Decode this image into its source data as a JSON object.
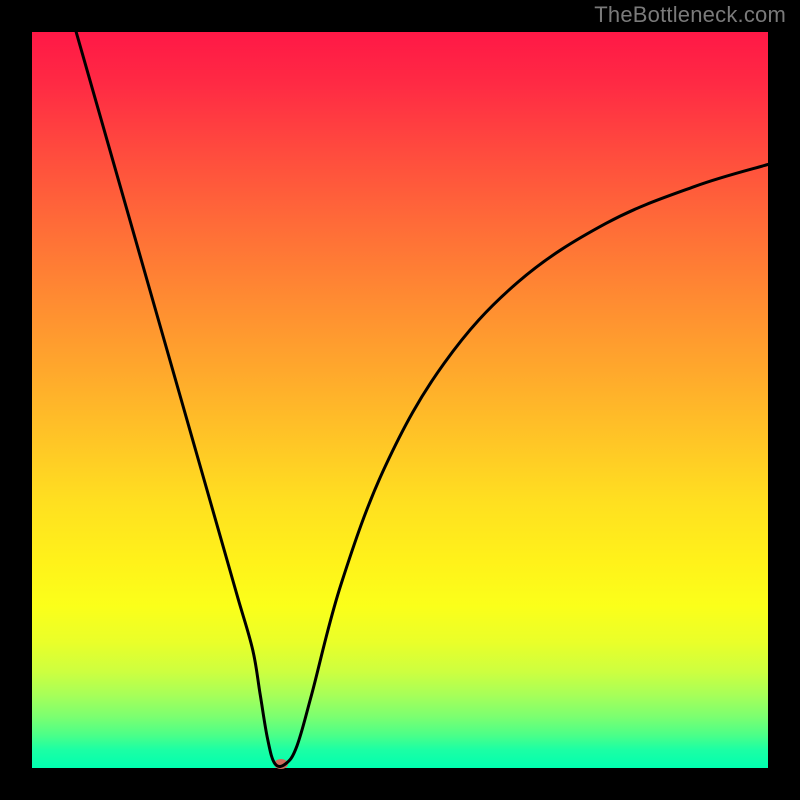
{
  "watermark": "TheBottleneck.com",
  "chart_data": {
    "type": "line",
    "title": "",
    "xlabel": "",
    "ylabel": "",
    "xlim": [
      0,
      100
    ],
    "ylim": [
      0,
      100
    ],
    "grid": false,
    "legend": false,
    "background_gradient": {
      "top_color": "#ff1846",
      "mid_color": "#ffe020",
      "bottom_color": "#00ffb0"
    },
    "series": [
      {
        "name": "bottleneck-curve",
        "color": "#000000",
        "x": [
          6,
          10,
          14,
          18,
          22,
          26,
          28,
          30,
          31,
          32,
          33,
          34.5,
          36,
          38,
          42,
          48,
          56,
          66,
          78,
          90,
          100
        ],
        "y": [
          100,
          86,
          72,
          58,
          44,
          30,
          23,
          16,
          10,
          4,
          0.6,
          0.6,
          3,
          10,
          25,
          41,
          55,
          66,
          74,
          79,
          82
        ]
      }
    ],
    "marker": {
      "name": "optimal-point",
      "color": "#d06a5a",
      "x": 33.8,
      "y": 0.6
    }
  }
}
